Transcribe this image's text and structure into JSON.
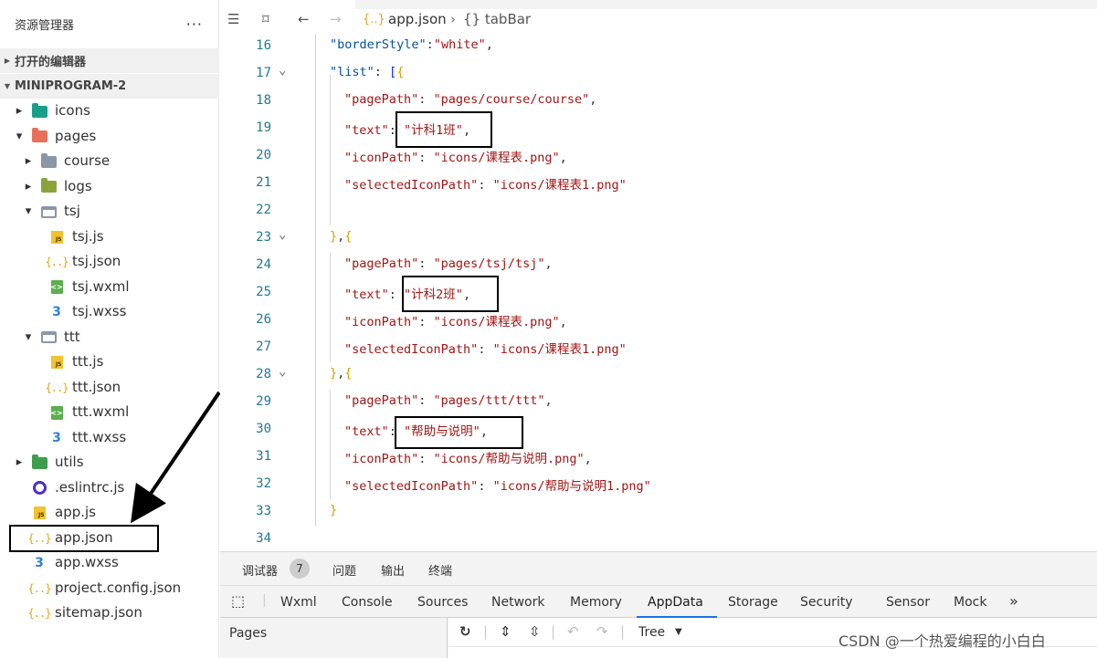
{
  "sidebar": {
    "title": "资源管理器",
    "more": "···",
    "open_editors": "打开的编辑器",
    "project": "MINIPROGRAM-2",
    "items": [
      {
        "label": "icons",
        "type": "folder-teal",
        "depth": 1,
        "arrow": "▶"
      },
      {
        "label": "pages",
        "type": "folder-red",
        "depth": 1,
        "arrow": "▼"
      },
      {
        "label": "course",
        "type": "folder-grey",
        "depth": 2,
        "arrow": "▶"
      },
      {
        "label": "logs",
        "type": "folder-olive",
        "depth": 2,
        "arrow": "▶"
      },
      {
        "label": "tsj",
        "type": "folder-open",
        "depth": 2,
        "arrow": "▼"
      },
      {
        "label": "tsj.js",
        "type": "js",
        "depth": 3
      },
      {
        "label": "tsj.json",
        "type": "json",
        "depth": 3
      },
      {
        "label": "tsj.wxml",
        "type": "wxml",
        "depth": 3
      },
      {
        "label": "tsj.wxss",
        "type": "wxss",
        "depth": 3
      },
      {
        "label": "ttt",
        "type": "folder-open",
        "depth": 2,
        "arrow": "▼"
      },
      {
        "label": "ttt.js",
        "type": "js",
        "depth": 3
      },
      {
        "label": "ttt.json",
        "type": "json",
        "depth": 3
      },
      {
        "label": "ttt.wxml",
        "type": "wxml",
        "depth": 3
      },
      {
        "label": "ttt.wxss",
        "type": "wxss",
        "depth": 3
      },
      {
        "label": "utils",
        "type": "folder-green",
        "depth": 1,
        "arrow": "▶"
      },
      {
        "label": ".eslintrc.js",
        "type": "eslint",
        "depth": 1
      },
      {
        "label": "app.js",
        "type": "js",
        "depth": 1
      },
      {
        "label": "app.json",
        "type": "json",
        "depth": 1,
        "selected": true
      },
      {
        "label": "app.wxss",
        "type": "wxss",
        "depth": 1
      },
      {
        "label": "project.config.json",
        "type": "json",
        "depth": 1
      },
      {
        "label": "sitemap.json",
        "type": "json",
        "depth": 1
      }
    ]
  },
  "editor": {
    "breadcrumb": {
      "file": "app.json",
      "separator": "›",
      "symbol": "{} tabBar"
    },
    "json_icon": "{..}",
    "lines": [
      {
        "n": "16",
        "fold": "",
        "indent": 0,
        "tokens": [
          [
            "k",
            "\"borderStyle\""
          ],
          [
            "o",
            ":"
          ],
          [
            "s",
            "\"white\""
          ],
          [
            "o",
            ","
          ]
        ]
      },
      {
        "n": "17",
        "fold": "⌄",
        "indent": 0,
        "tokens": [
          [
            "k",
            "\"list\""
          ],
          [
            "o",
            ": "
          ],
          [
            "b1",
            "["
          ],
          [
            "b2",
            "{"
          ]
        ]
      },
      {
        "n": "18",
        "fold": "",
        "indent": 1,
        "tokens": [
          [
            "p",
            "\"pagePath\""
          ],
          [
            "o",
            ": "
          ],
          [
            "s",
            "\"pages/course/course\""
          ],
          [
            "o",
            ","
          ]
        ]
      },
      {
        "n": "19",
        "fold": "",
        "indent": 1,
        "tokens": [
          [
            "p",
            "\"text\""
          ],
          [
            "o",
            ": "
          ],
          [
            "s",
            "\"计科1班\""
          ],
          [
            "o",
            ","
          ]
        ]
      },
      {
        "n": "20",
        "fold": "",
        "indent": 1,
        "tokens": [
          [
            "p",
            "\"iconPath\""
          ],
          [
            "o",
            ": "
          ],
          [
            "s",
            "\"icons/课程表.png\""
          ],
          [
            "o",
            ","
          ]
        ]
      },
      {
        "n": "21",
        "fold": "",
        "indent": 1,
        "tokens": [
          [
            "p",
            "\"selectedIconPath\""
          ],
          [
            "o",
            ": "
          ],
          [
            "s",
            "\"icons/课程表1.png\""
          ]
        ]
      },
      {
        "n": "22",
        "fold": "",
        "indent": 1,
        "tokens": []
      },
      {
        "n": "23",
        "fold": "⌄",
        "indent": 0,
        "tokens": [
          [
            "b2",
            "}"
          ],
          [
            "o",
            ","
          ],
          [
            "b2",
            "{"
          ]
        ]
      },
      {
        "n": "24",
        "fold": "",
        "indent": 1,
        "tokens": [
          [
            "p",
            "\"pagePath\""
          ],
          [
            "o",
            ": "
          ],
          [
            "s",
            "\"pages/tsj/tsj\""
          ],
          [
            "o",
            ","
          ]
        ]
      },
      {
        "n": "25",
        "fold": "",
        "indent": 1,
        "tokens": [
          [
            "p",
            "\"text\""
          ],
          [
            "o",
            ": "
          ],
          [
            "s",
            "\"计科2班\""
          ],
          [
            "o",
            ","
          ]
        ]
      },
      {
        "n": "26",
        "fold": "",
        "indent": 1,
        "tokens": [
          [
            "p",
            "\"iconPath\""
          ],
          [
            "o",
            ": "
          ],
          [
            "s",
            "\"icons/课程表.png\""
          ],
          [
            "o",
            ","
          ]
        ]
      },
      {
        "n": "27",
        "fold": "",
        "indent": 1,
        "tokens": [
          [
            "p",
            "\"selectedIconPath\""
          ],
          [
            "o",
            ": "
          ],
          [
            "s",
            "\"icons/课程表1.png\""
          ]
        ]
      },
      {
        "n": "28",
        "fold": "⌄",
        "indent": 0,
        "tokens": [
          [
            "b2",
            "}"
          ],
          [
            "o",
            ","
          ],
          [
            "b2",
            "{"
          ]
        ]
      },
      {
        "n": "29",
        "fold": "",
        "indent": 1,
        "tokens": [
          [
            "p",
            "\"pagePath\""
          ],
          [
            "o",
            ": "
          ],
          [
            "s",
            "\"pages/ttt/ttt\""
          ],
          [
            "o",
            ","
          ]
        ]
      },
      {
        "n": "30",
        "fold": "",
        "indent": 1,
        "tokens": [
          [
            "p",
            "\"text\""
          ],
          [
            "o",
            ": "
          ],
          [
            "s",
            "\"帮助与说明\""
          ],
          [
            "o",
            ","
          ]
        ]
      },
      {
        "n": "31",
        "fold": "",
        "indent": 1,
        "tokens": [
          [
            "p",
            "\"iconPath\""
          ],
          [
            "o",
            ": "
          ],
          [
            "s",
            "\"icons/帮助与说明.png\""
          ],
          [
            "o",
            ","
          ]
        ]
      },
      {
        "n": "32",
        "fold": "",
        "indent": 1,
        "tokens": [
          [
            "p",
            "\"selectedIconPath\""
          ],
          [
            "o",
            ": "
          ],
          [
            "s",
            "\"icons/帮助与说明1.png\""
          ]
        ]
      },
      {
        "n": "33",
        "fold": "",
        "indent": 0,
        "tokens": [
          [
            "b2",
            "}"
          ]
        ]
      },
      {
        "n": "34",
        "fold": "",
        "indent": 0,
        "tokens": []
      }
    ]
  },
  "devtools": {
    "tabs": {
      "debugger": "调试器",
      "badge": "7",
      "problems": "问题",
      "output": "输出",
      "terminal": "终端"
    },
    "panels": [
      "Wxml",
      "Console",
      "Sources",
      "Network",
      "Memory",
      "AppData",
      "Storage",
      "Security",
      "Sensor",
      "Mock"
    ],
    "more_panels": "»",
    "active_panel": "AppData",
    "pages_header": "Pages",
    "view_mode": "Tree",
    "dropdown_caret": "▼"
  },
  "watermark": "CSDN @一个热爱编程的小白白"
}
